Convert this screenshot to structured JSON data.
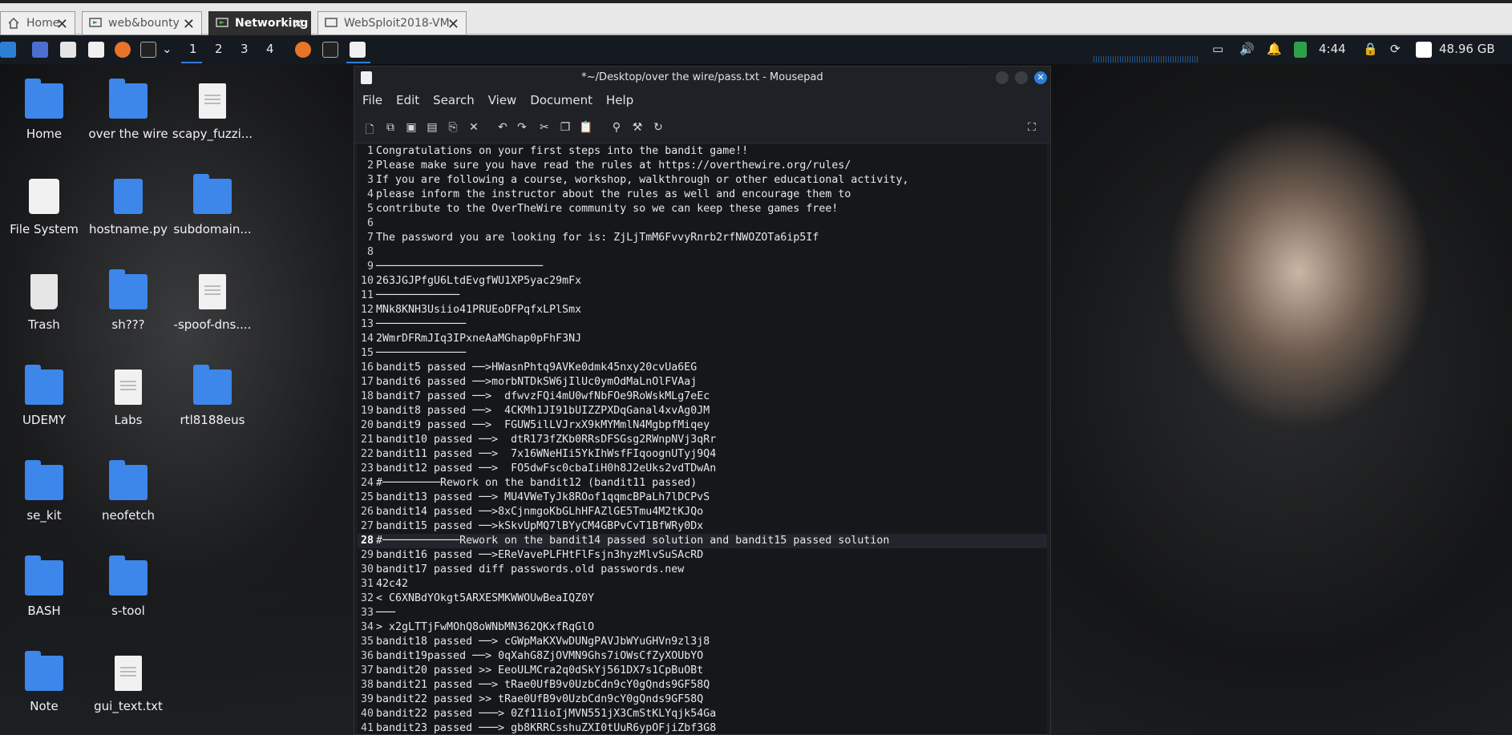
{
  "vm_tabs": [
    {
      "label": "Home",
      "active": false
    },
    {
      "label": "web&bounty",
      "active": false
    },
    {
      "label": "Networking",
      "active": true
    },
    {
      "label": "WebSploit2018-VM",
      "active": false
    }
  ],
  "panel": {
    "workspaces": [
      "1",
      "2",
      "3",
      "4"
    ],
    "clock": "4:44",
    "disk": "48.96 GB"
  },
  "desktop_icons": [
    {
      "label": "Home",
      "kind": "folder-home"
    },
    {
      "label": "over the wire",
      "kind": "folder"
    },
    {
      "label": "scapy_fuzzi...",
      "kind": "doc"
    },
    {
      "label": "File System",
      "kind": "drive"
    },
    {
      "label": "hostname.py",
      "kind": "python"
    },
    {
      "label": "subdomain...",
      "kind": "folder-star"
    },
    {
      "label": "Trash",
      "kind": "trash"
    },
    {
      "label": "sh???",
      "kind": "folder-locked"
    },
    {
      "label": "-spoof-dns....",
      "kind": "doc"
    },
    {
      "label": "UDEMY",
      "kind": "folder"
    },
    {
      "label": "Labs",
      "kind": "doc"
    },
    {
      "label": "rtl8188eus",
      "kind": "folder"
    },
    {
      "label": "se_kit",
      "kind": "folder"
    },
    {
      "label": "neofetch",
      "kind": "folder"
    },
    {
      "label": "BASH",
      "kind": "folder"
    },
    {
      "label": "s-tool",
      "kind": "folder"
    },
    {
      "label": "Note",
      "kind": "folder"
    },
    {
      "label": "gui_text.txt",
      "kind": "doc"
    }
  ],
  "window": {
    "title": "*~/Desktop/over the wire/pass.txt - Mousepad",
    "menu": [
      "File",
      "Edit",
      "Search",
      "View",
      "Document",
      "Help"
    ]
  },
  "editor": {
    "current_line": 28,
    "lines": [
      "Congratulations on your first steps into the bandit game!!",
      "Please make sure you have read the rules at https://overthewire.org/rules/",
      "If you are following a course, workshop, walkthrough or other educational activity,",
      "please inform the instructor about the rules as well and encourage them to",
      "contribute to the OverTheWire community so we can keep these games free!",
      "",
      "The password you are looking for is: ZjLjTmM6FvvyRnrb2rfNWOZOTa6ip5If",
      "",
      "──────────────────────────",
      "263JGJPfgU6LtdEvgfWU1XP5yac29mFx",
      "─────────────",
      "MNk8KNH3Usiio41PRUEoDFPqfxLPlSmx",
      "──────────────",
      "2WmrDFRmJIq3IPxneAaMGhap0pFhF3NJ",
      "──────────────",
      "bandit5 passed ──>HWasnPhtq9AVKe0dmk45nxy20cvUa6EG",
      "bandit6 passed ──>morbNTDkSW6jIlUc0ymOdMaLnOlFVAaj",
      "bandit7 passed ──>  dfwvzFQi4mU0wfNbFOe9RoWskMLg7eEc",
      "bandit8 passed ──>  4CKMh1JI91bUIZZPXDqGanal4xvAg0JM",
      "bandit9 passed ──>  FGUW5ilLVJrxX9kMYMmlN4MgbpfMiqey",
      "bandit10 passed ──>  dtR173fZKb0RRsDFSGsg2RWnpNVj3qRr",
      "bandit11 passed ──>  7x16WNeHIi5YkIhWsfFIqoognUTyj9Q4",
      "bandit12 passed ──>  FO5dwFsc0cbaIiH0h8J2eUks2vdTDwAn",
      "#─────────Rework on the bandit12 (bandit11 passed)",
      "bandit13 passed ──> MU4VWeTyJk8ROof1qqmcBPaLh7lDCPvS",
      "bandit14 passed ──>8xCjnmgoKbGLhHFAZlGE5Tmu4M2tKJQo",
      "bandit15 passed ──>kSkvUpMQ7lBYyCM4GBPvCvT1BfWRy0Dx",
      "#────────────Rework on the bandit14 passed solution and bandit15 passed solution",
      "bandit16 passed ──>EReVavePLFHtFlFsjn3hyzMlvSuSAcRD",
      "bandit17 passed diff passwords.old passwords.new",
      "42c42",
      "< C6XNBdYOkgt5ARXESMKWWOUwBeaIQZ0Y",
      "───",
      "> x2gLTTjFwMOhQ8oWNbMN362QKxfRqGlO",
      "bandit18 passed ──> cGWpMaKXVwDUNgPAVJbWYuGHVn9zl3j8",
      "bandit19passed ──> 0qXahG8ZjOVMN9Ghs7iOWsCfZyXOUbYO",
      "bandit20 passed >> EeoULMCra2q0dSkYj561DX7s1CpBuOBt",
      "bandit21 passed ──> tRae0UfB9v0UzbCdn9cY0gQnds9GF58Q",
      "bandit22 passed >> tRae0UfB9v0UzbCdn9cY0gQnds9GF58Q",
      "bandit22 passed ───> 0Zf11ioIjMVN551jX3CmStKLYqjk54Ga",
      "bandit23 passed ───> gb8KRRCsshuZXI0tUuR6ypOFjiZbf3G8"
    ]
  }
}
